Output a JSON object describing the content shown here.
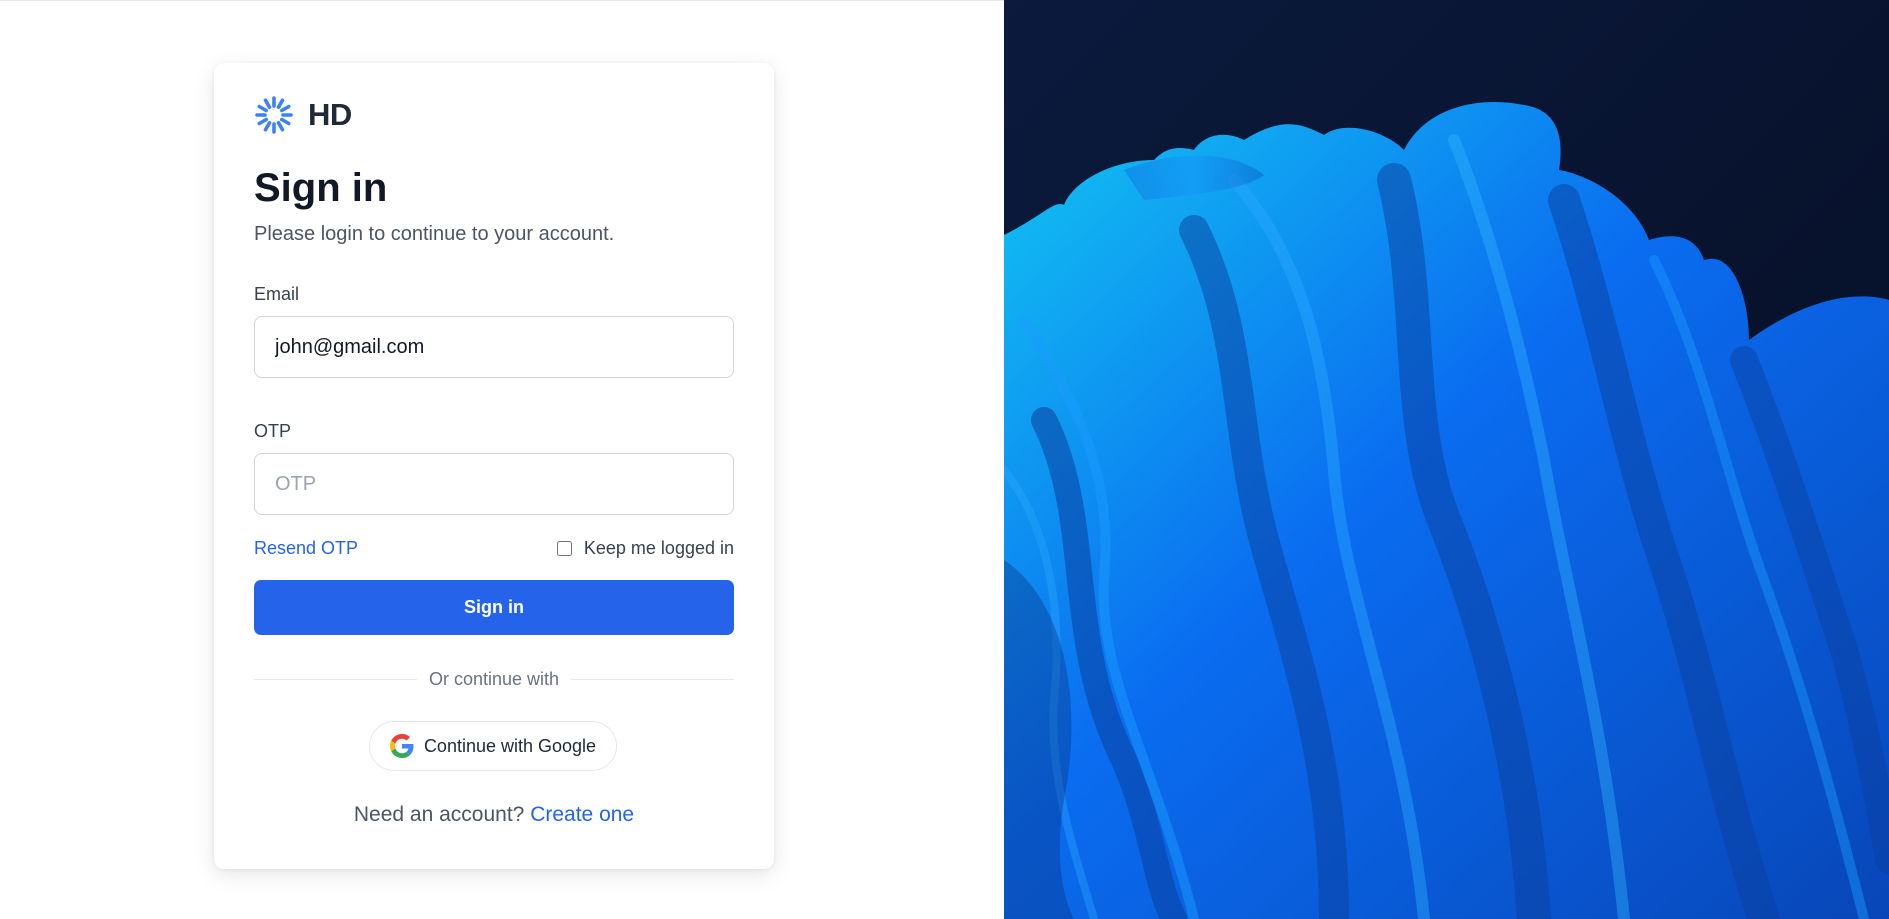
{
  "brand": {
    "name": "HD",
    "logo_icon": "spinner-sun-icon",
    "accent": "#3b82f6"
  },
  "form": {
    "title": "Sign in",
    "subtitle": "Please login to continue to your account.",
    "email": {
      "label": "Email",
      "value": "john@gmail.com"
    },
    "otp": {
      "label": "OTP",
      "value": "",
      "placeholder": "OTP"
    },
    "resend_label": "Resend OTP",
    "remember": {
      "label": "Keep me logged in",
      "checked": false
    },
    "submit_label": "Sign in",
    "divider_text": "Or continue with",
    "google_label": "Continue with Google",
    "google_icon": "google-icon",
    "account_prompt": "Need an account?",
    "create_label": "Create one"
  },
  "colors": {
    "primary": "#2563eb",
    "link": "#2563eb",
    "heading": "#111827"
  },
  "hero": {
    "image": "blue-abstract-wave-art",
    "background": "#06122a",
    "wave_color": "#0a6cf0"
  }
}
